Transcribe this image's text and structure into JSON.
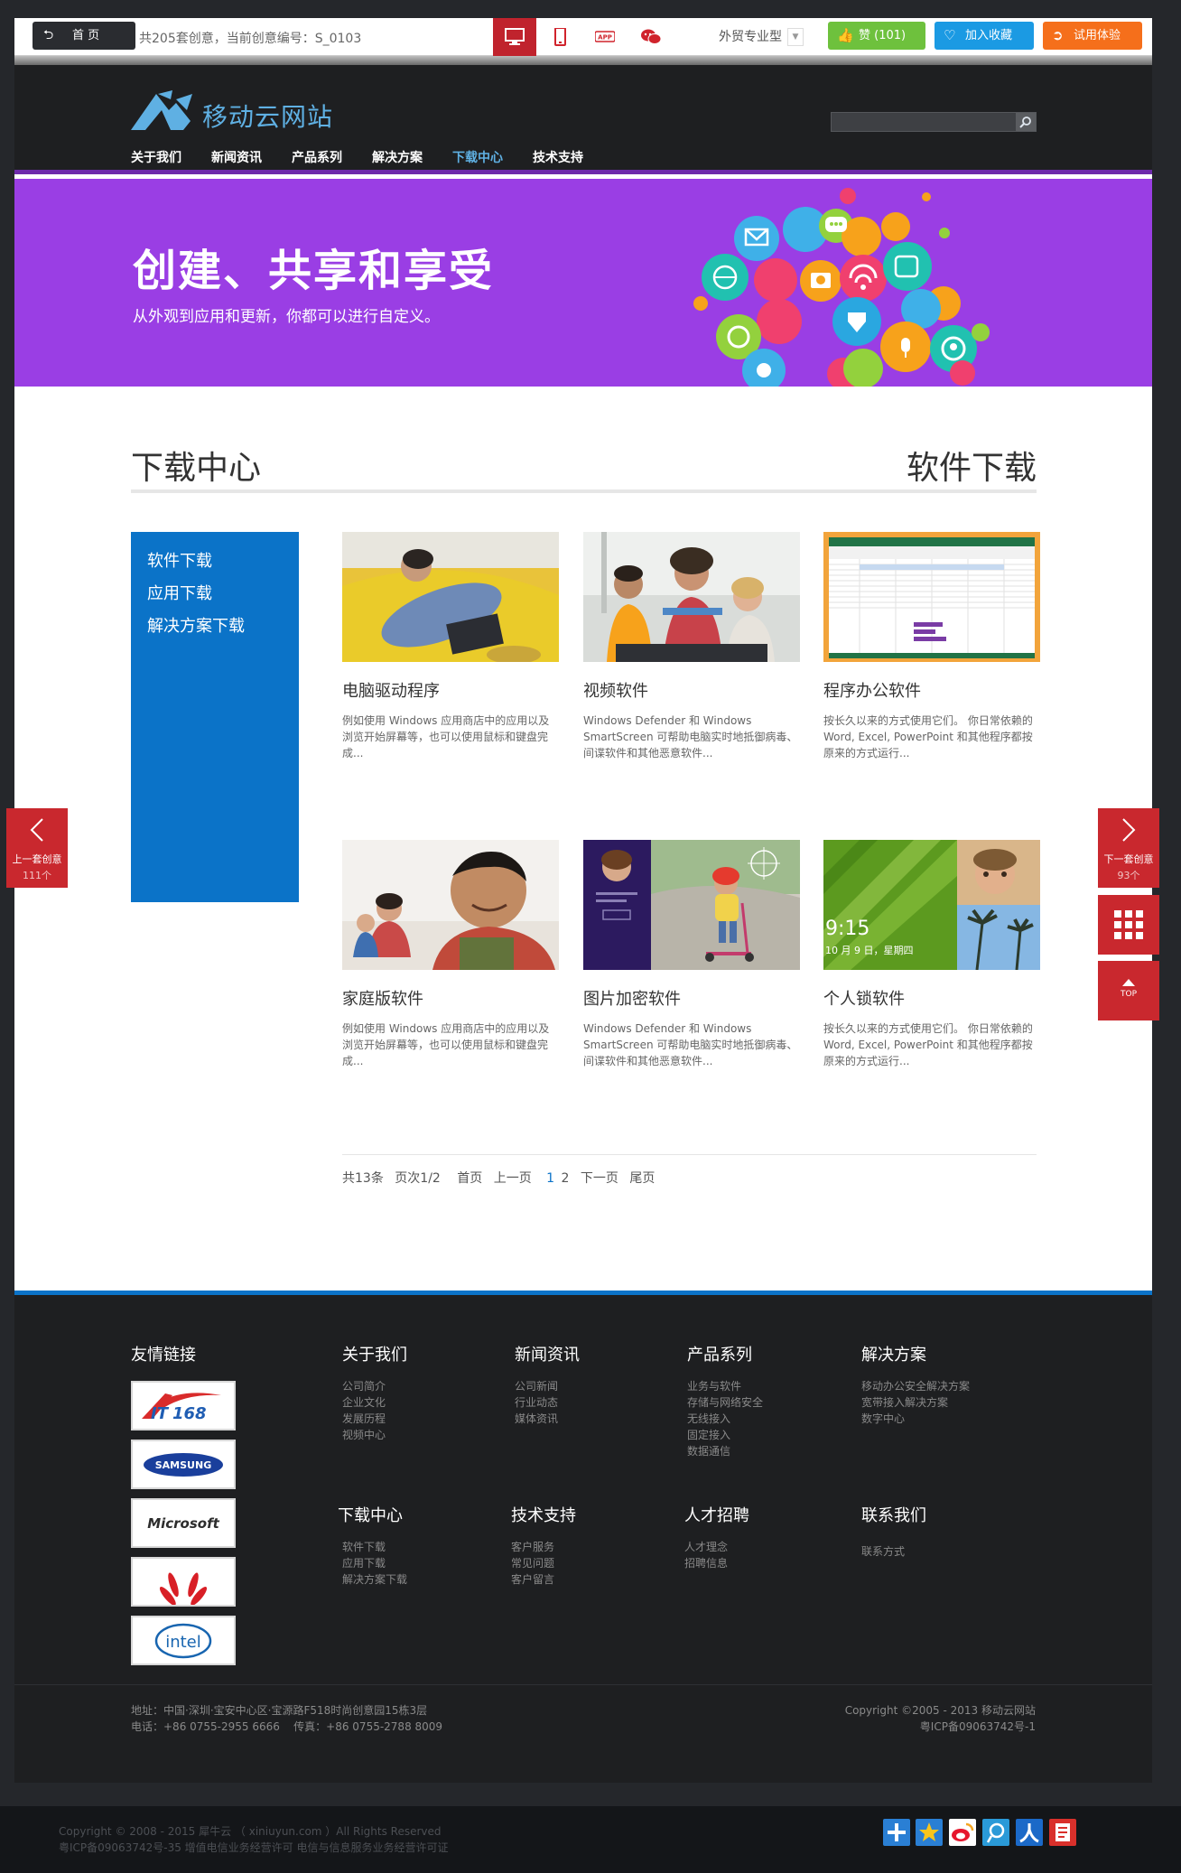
{
  "toolbar": {
    "home_label": "首 页",
    "info_prefix": "共205套创意，当前创意编号：",
    "info_code": "S_0103",
    "device_icons": [
      "desktop-icon",
      "tablet-icon",
      "app-icon",
      "wechat-icon"
    ],
    "style_select": "外贸专业型",
    "like_label": "赞 (101)",
    "favorite_label": "加入收藏",
    "trial_label": "试用体验",
    "colors": {
      "active_device": "#c0232d",
      "like": "#6ec13d",
      "favorite": "#1b9ae3",
      "trial": "#f56f1b"
    }
  },
  "site": {
    "logo_text": "移动云网站",
    "nav": [
      "关于我们",
      "新闻资讯",
      "产品系列",
      "解决方案",
      "下载中心",
      "技术支持"
    ],
    "nav_active_index": 4,
    "hero": {
      "title": "创建、共享和享受",
      "subtitle": "从外观到应用和更新，你都可以进行自定义。",
      "background": "#9a3ee4"
    },
    "section_title": "下载中心",
    "section_current": "软件下载",
    "side_menu": [
      "软件下载",
      "应用下载",
      "解决方案下载"
    ],
    "cards": [
      {
        "title": "电脑驱动程序",
        "desc": "例如使用 Windows 应用商店中的应用以及浏览开始屏幕等，也可以使用鼠标和键盘完成..."
      },
      {
        "title": "视频软件",
        "desc": "Windows Defender 和 Windows SmartScreen 可帮助电脑实时地抵御病毒、间谍软件和其他恶意软件..."
      },
      {
        "title": "程序办公软件",
        "desc": "按长久以来的方式使用它们。 你日常依赖的 Word, Excel, PowerPoint 和其他程序都按原来的方式运行..."
      },
      {
        "title": "家庭版软件",
        "desc": "例如使用 Windows 应用商店中的应用以及浏览开始屏幕等，也可以使用鼠标和键盘完成..."
      },
      {
        "title": "图片加密软件",
        "desc": "Windows Defender 和 Windows SmartScreen 可帮助电脑实时地抵御病毒、间谍软件和其他恶意软件..."
      },
      {
        "title": "个人锁软件",
        "desc": "按长久以来的方式使用它们。 你日常依赖的 Word, Excel, PowerPoint 和其他程序都按原来的方式运行..."
      }
    ],
    "lock_time": "9:15",
    "lock_date": "10 月 9 日，星期四",
    "pager": {
      "total": "共13条",
      "page_info": "页次1/2",
      "first": "首页",
      "prev": "上一页",
      "page1": "1",
      "page2": "2",
      "next": "下一页",
      "last": "尾页"
    },
    "footer": {
      "friend_links_title": "友情链接",
      "partners": [
        "IT168",
        "SAMSUNG",
        "Microsoft",
        "HUAWEI",
        "intel"
      ],
      "columns": [
        {
          "title": "关于我们",
          "links": [
            "公司简介",
            "企业文化",
            "发展历程",
            "视频中心"
          ]
        },
        {
          "title": "新闻资讯",
          "links": [
            "公司新闻",
            "行业动态",
            "媒体资讯"
          ]
        },
        {
          "title": "产品系列",
          "links": [
            "业务与软件",
            "存储与网络安全",
            "无线接入",
            "固定接入",
            "数据通信"
          ]
        },
        {
          "title": "解决方案",
          "links": [
            "移动办公安全解决方案",
            "宽带接入解决方案",
            "数字中心"
          ]
        },
        {
          "title": "下载中心",
          "links": [
            "软件下载",
            "应用下载",
            "解决方案下载"
          ]
        },
        {
          "title": "技术支持",
          "links": [
            "客户服务",
            "常见问题",
            "客户留言"
          ]
        },
        {
          "title": "人才招聘",
          "links": [
            "人才理念",
            "招聘信息"
          ]
        },
        {
          "title": "联系我们",
          "links": [
            "联系方式"
          ]
        }
      ],
      "address": "地址：中国·深圳·宝安中心区·宝源路F518时尚创意园15栋3层",
      "phone": "电话：+86 0755-2955 6666    传真：+86 0755-2788 8009",
      "copyright": "Copyright ©2005 - 2013 移动云网站",
      "icp": "粤ICP备09063742号-1"
    }
  },
  "side_nav": {
    "prev_label": "上一套创意",
    "prev_count": "111个",
    "next_label": "下一套创意",
    "next_count": "93个",
    "top_label": "TOP",
    "color": "#c9282e"
  },
  "platform": {
    "copyright": "Copyright © 2008 - 2015 犀牛云 （ xiniuyun.com ）All Rights Reserved",
    "license": "粤ICP备09063742号-35 增值电信业务经营许可 电信与信息服务业务经营许可证",
    "share_icons": [
      "qzone-icon",
      "qq-favorite-icon",
      "weibo-icon",
      "tencent-weibo-icon",
      "renren-icon",
      "douban-icon"
    ]
  }
}
